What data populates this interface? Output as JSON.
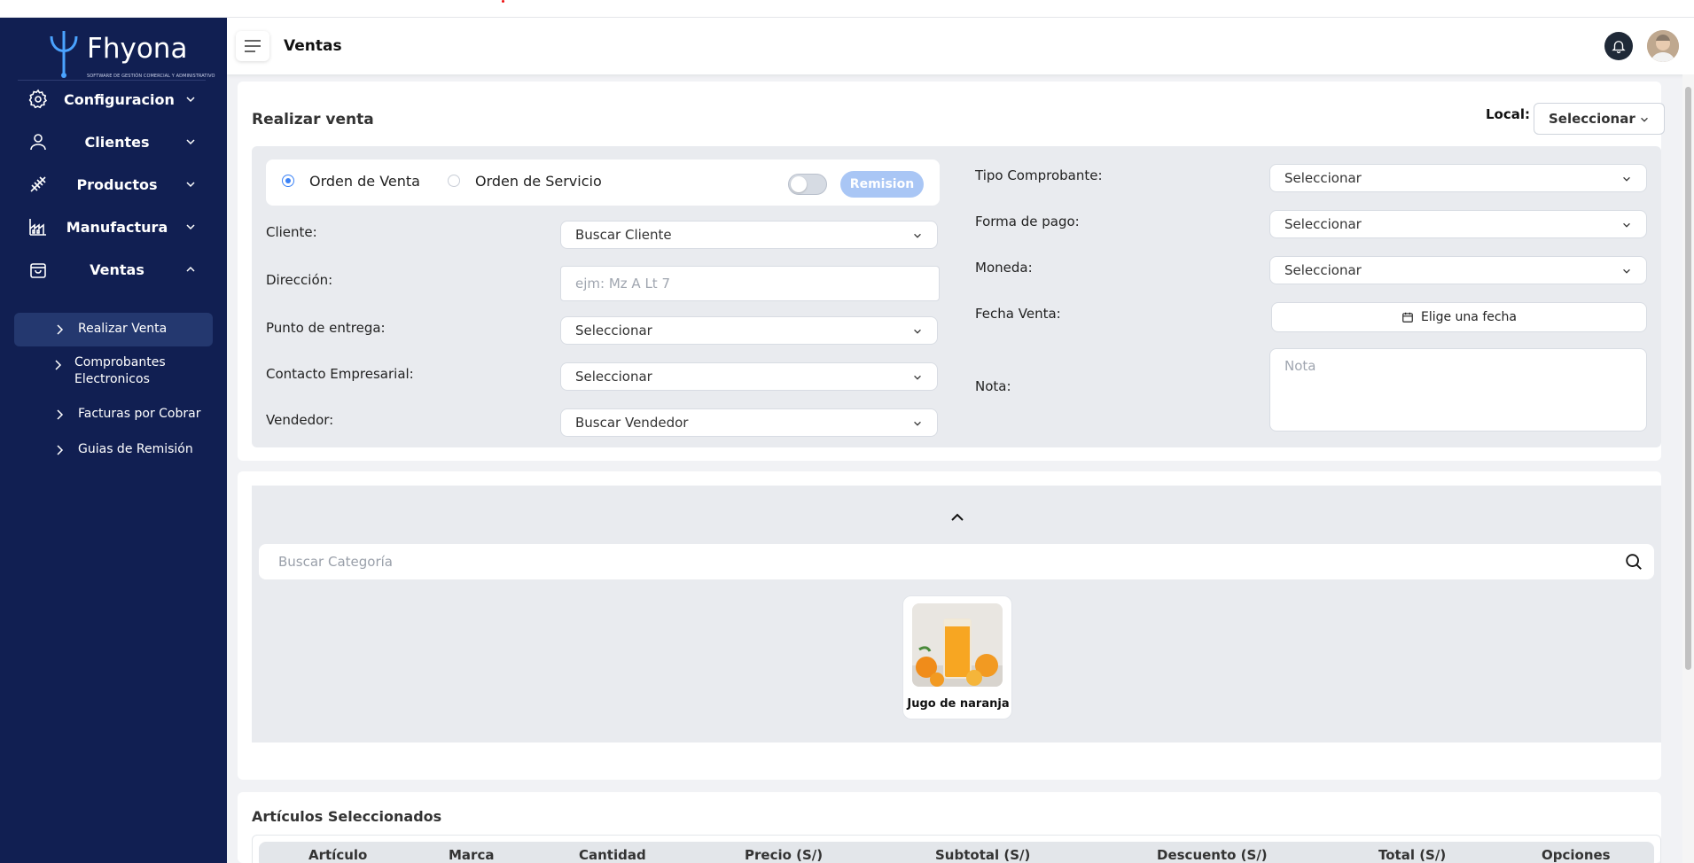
{
  "app": {
    "logo_text": "Fhyona",
    "logo_subtitle": "SOFTWARE DE GESTIÓN COMERCIAL Y ADMINISTRATIVO",
    "page_title": "Ventas"
  },
  "sidebar": {
    "items": [
      {
        "label": "Configuracion",
        "icon": "gear-icon"
      },
      {
        "label": "Clientes",
        "icon": "user-icon"
      },
      {
        "label": "Productos",
        "icon": "products-icon"
      },
      {
        "label": "Manufactura",
        "icon": "factory-icon"
      },
      {
        "label": "Ventas",
        "icon": "shopping-bag-icon"
      }
    ],
    "subitems": [
      {
        "label": "Realizar Venta",
        "active": true
      },
      {
        "label": "Comprobantes Electronicos",
        "active": false
      },
      {
        "label": "Facturas por Cobrar",
        "active": false
      },
      {
        "label": "Guias de Remisión",
        "active": false
      }
    ]
  },
  "venta": {
    "title": "Realizar venta",
    "local_label": "Local:",
    "local_value": "Seleccionar",
    "radio_orden_venta": "Orden de Venta",
    "radio_orden_servicio": "Orden de Servicio",
    "selected_radio": "Orden de Venta",
    "remision_toggle_on": false,
    "remision_label": "Remision",
    "cliente_label": "Cliente:",
    "cliente_value": "Buscar Cliente",
    "direccion_label": "Dirección:",
    "direccion_placeholder": "ejm: Mz A Lt 7",
    "punto_label": "Punto de entrega:",
    "punto_value": "Seleccionar",
    "contacto_label": "Contacto Empresarial:",
    "contacto_value": "Seleccionar",
    "vendedor_label": "Vendedor:",
    "vendedor_value": "Buscar Vendedor",
    "tipo_label": "Tipo Comprobante:",
    "tipo_value": "Seleccionar",
    "forma_label": "Forma de pago:",
    "forma_value": "Seleccionar",
    "moneda_label": "Moneda:",
    "moneda_value": "Seleccionar",
    "fecha_label": "Fecha Venta:",
    "fecha_value": "Elige una fecha",
    "nota_label": "Nota:",
    "nota_placeholder": "Nota"
  },
  "catalog": {
    "search_placeholder": "Buscar Categoría",
    "products": [
      {
        "name": "Jugo de naranja"
      }
    ]
  },
  "selected": {
    "title": "Artículos Seleccionados",
    "columns": [
      "Artículo",
      "Marca",
      "Cantidad",
      "Precio (S/)",
      "Subtotal (S/)",
      "Descuento (S/)",
      "Total (S/)",
      "Opciones"
    ]
  },
  "colors": {
    "sidebar_bg": "#111f52",
    "active_bg": "#24386f",
    "accent": "#3b82f6",
    "remision_btn": "#a9c6f5"
  }
}
